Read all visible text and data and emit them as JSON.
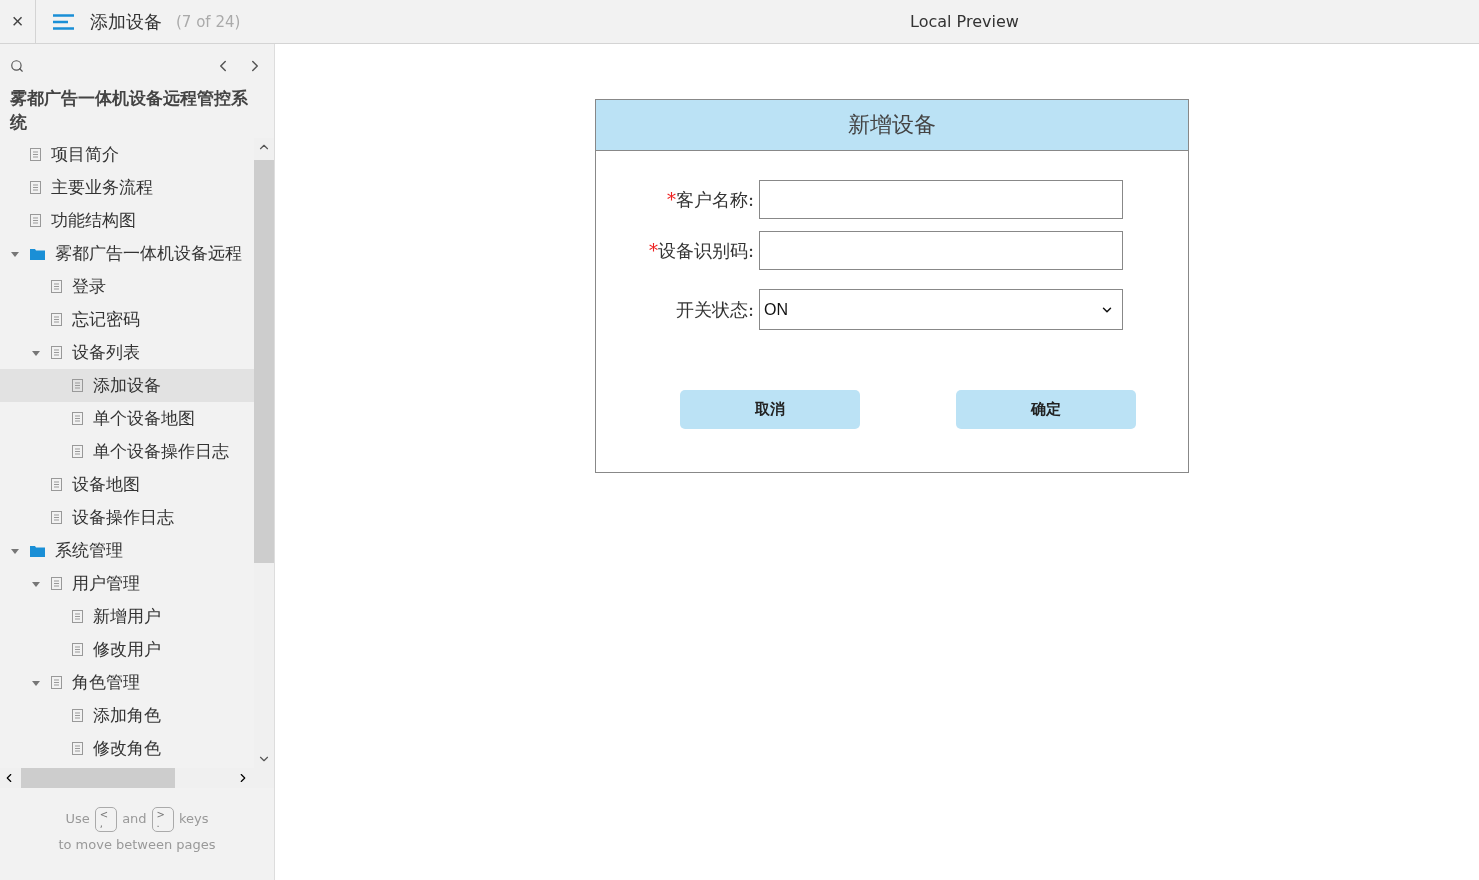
{
  "header": {
    "close": "×",
    "page_title": "添加设备",
    "page_count": "(7 of 24)",
    "center_title": "Local Preview"
  },
  "sidebar": {
    "project_title": "雾都广告一体机设备远程管控系统",
    "tree": [
      {
        "label": "项目简介",
        "kind": "page",
        "selected": false
      },
      {
        "label": "主要业务流程",
        "kind": "page",
        "selected": false
      },
      {
        "label": "功能结构图",
        "kind": "page",
        "selected": false
      },
      {
        "label": "雾都广告一体机设备远程",
        "kind": "folder",
        "selected": false,
        "expanded": true,
        "children": [
          {
            "label": "登录",
            "kind": "page",
            "selected": false
          },
          {
            "label": "忘记密码",
            "kind": "page",
            "selected": false
          },
          {
            "label": "设备列表",
            "kind": "page",
            "selected": false,
            "expanded": true,
            "children": [
              {
                "label": "添加设备",
                "kind": "page",
                "selected": true
              },
              {
                "label": "单个设备地图",
                "kind": "page",
                "selected": false
              },
              {
                "label": "单个设备操作日志",
                "kind": "page",
                "selected": false
              }
            ]
          },
          {
            "label": "设备地图",
            "kind": "page",
            "selected": false
          },
          {
            "label": "设备操作日志",
            "kind": "page",
            "selected": false
          }
        ]
      },
      {
        "label": "系统管理",
        "kind": "folder",
        "selected": false,
        "expanded": true,
        "children": [
          {
            "label": "用户管理",
            "kind": "page",
            "selected": false,
            "expanded": true,
            "children": [
              {
                "label": "新增用户",
                "kind": "page",
                "selected": false
              },
              {
                "label": "修改用户",
                "kind": "page",
                "selected": false
              }
            ]
          },
          {
            "label": "角色管理",
            "kind": "page",
            "selected": false,
            "expanded": true,
            "children": [
              {
                "label": "添加角色",
                "kind": "page",
                "selected": false
              },
              {
                "label": "修改角色",
                "kind": "page",
                "selected": false
              }
            ]
          }
        ]
      }
    ],
    "hint": {
      "use": "Use",
      "key_prev": "<\n,",
      "and": "and",
      "key_next": ">\n.",
      "keys": "keys",
      "line2": "to move between pages"
    }
  },
  "form": {
    "title": "新增设备",
    "fields": [
      {
        "kind": "text",
        "required": true,
        "label": "客户名称:"
      },
      {
        "kind": "text",
        "required": true,
        "label": "设备识别码:"
      },
      {
        "kind": "select",
        "required": false,
        "label": "开关状态:",
        "value": "ON"
      }
    ],
    "required_mark": "*",
    "buttons": [
      "取消",
      "确定"
    ]
  }
}
